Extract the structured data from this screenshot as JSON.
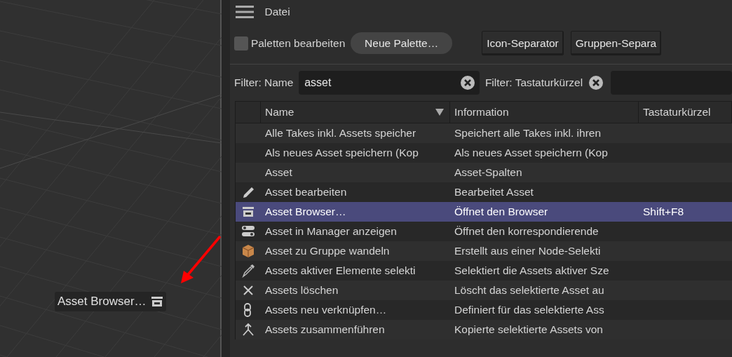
{
  "menu": {
    "title": "Datei"
  },
  "toolbar": {
    "edit_palettes": {
      "label": "Paletten bearbeiten",
      "checked": false
    },
    "buttons": [
      {
        "label": "Neue Palette…",
        "kind": "pill"
      },
      {
        "label": "Icon-Separator",
        "kind": "square"
      },
      {
        "label": "Gruppen-Separa",
        "kind": "square"
      }
    ]
  },
  "filters": [
    {
      "label": "Filter: Name",
      "value": "asset"
    },
    {
      "label": "Filter: Tastaturkürzel"
    }
  ],
  "table": {
    "columns": [
      {
        "label": "Name",
        "sorted": true
      },
      {
        "label": "Information",
        "sorted": false
      },
      {
        "label": "Tastaturkürzel",
        "sorted": false
      }
    ],
    "rows": [
      {
        "name": "Alle Takes inkl. Assets speicher",
        "information": "Speichert alle Takes inkl. ihren",
        "selected": false
      },
      {
        "name": "Als neues Asset speichern (Kop",
        "information": "Als neues Asset speichern (Kop",
        "selected": false
      },
      {
        "name": "Asset",
        "information": "Asset-Spalten",
        "selected": false
      },
      {
        "name": "Asset bearbeiten",
        "information": "Bearbeitet Asset",
        "selected": false
      },
      {
        "name": "Asset Browser…",
        "information": "Öffnet den Browser",
        "shortcut": "Shift+F8",
        "selected": true
      },
      {
        "name": "Asset in Manager anzeigen",
        "information": "Öffnet den korrespondierende",
        "selected": false
      },
      {
        "name": "Asset zu Gruppe wandeln",
        "information": "Erstellt aus einer Node-Selekti",
        "selected": false
      },
      {
        "name": "Assets aktiver Elemente selekti",
        "information": "Selektiert die Assets aktiver Sze",
        "selected": false
      },
      {
        "name": "Assets löschen",
        "information": "Löscht das selektierte Asset au",
        "selected": false
      },
      {
        "name": "Assets neu verknüpfen…",
        "information": "Definiert für das selektierte Ass",
        "selected": false
      },
      {
        "name": "Assets zusammenführen",
        "information": "Kopierte selektierte Assets von",
        "selected": false
      }
    ]
  },
  "viewport": {
    "tooltip": "Asset Browser…"
  }
}
